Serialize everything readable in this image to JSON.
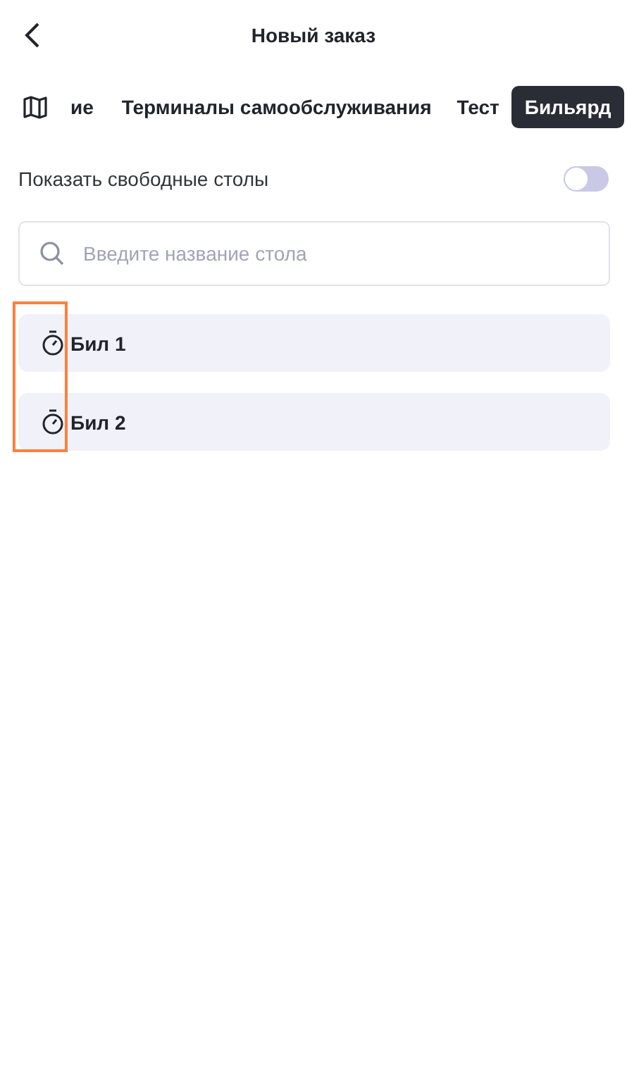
{
  "header": {
    "title": "Новый заказ"
  },
  "tabs": [
    {
      "label": "ие",
      "selected": false
    },
    {
      "label": "Терминалы самообслуживания",
      "selected": false
    },
    {
      "label": "Тест",
      "selected": false
    },
    {
      "label": "Бильярд",
      "selected": true
    }
  ],
  "free_tables": {
    "label": "Показать свободные столы",
    "on": false
  },
  "search": {
    "placeholder": "Введите название стола"
  },
  "tables": [
    {
      "name": "Бил 1"
    },
    {
      "name": "Бил 2"
    }
  ],
  "annotation_frame": true
}
